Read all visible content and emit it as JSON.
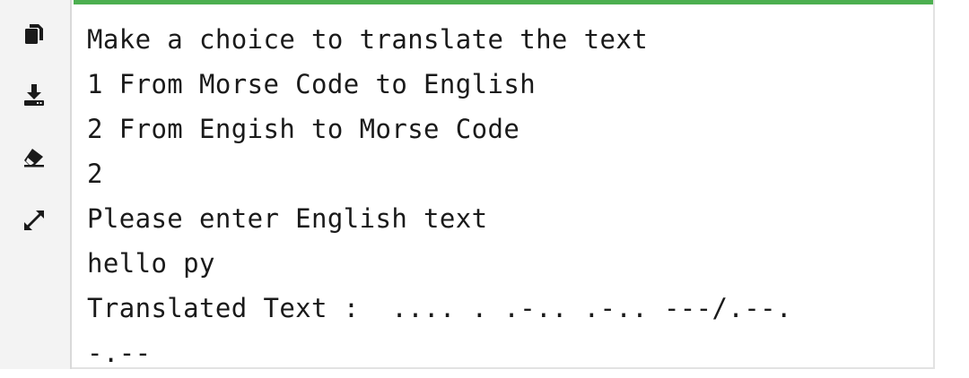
{
  "toolbar": {
    "icons": [
      {
        "name": "copy-icon"
      },
      {
        "name": "download-icon"
      },
      {
        "name": "eraser-icon"
      },
      {
        "name": "expand-icon"
      }
    ]
  },
  "output": {
    "lines": [
      "Make a choice to translate the text",
      "1 From Morse Code to English",
      "2 From Engish to Morse Code",
      "2",
      "Please enter English text",
      "hello py",
      "Translated Text :  .... . .-.. .-.. ---/.--.",
      "-.--"
    ]
  },
  "colors": {
    "accent": "#4caf50",
    "toolbar_bg": "#f3f3f3",
    "text": "#1a1a1a"
  }
}
